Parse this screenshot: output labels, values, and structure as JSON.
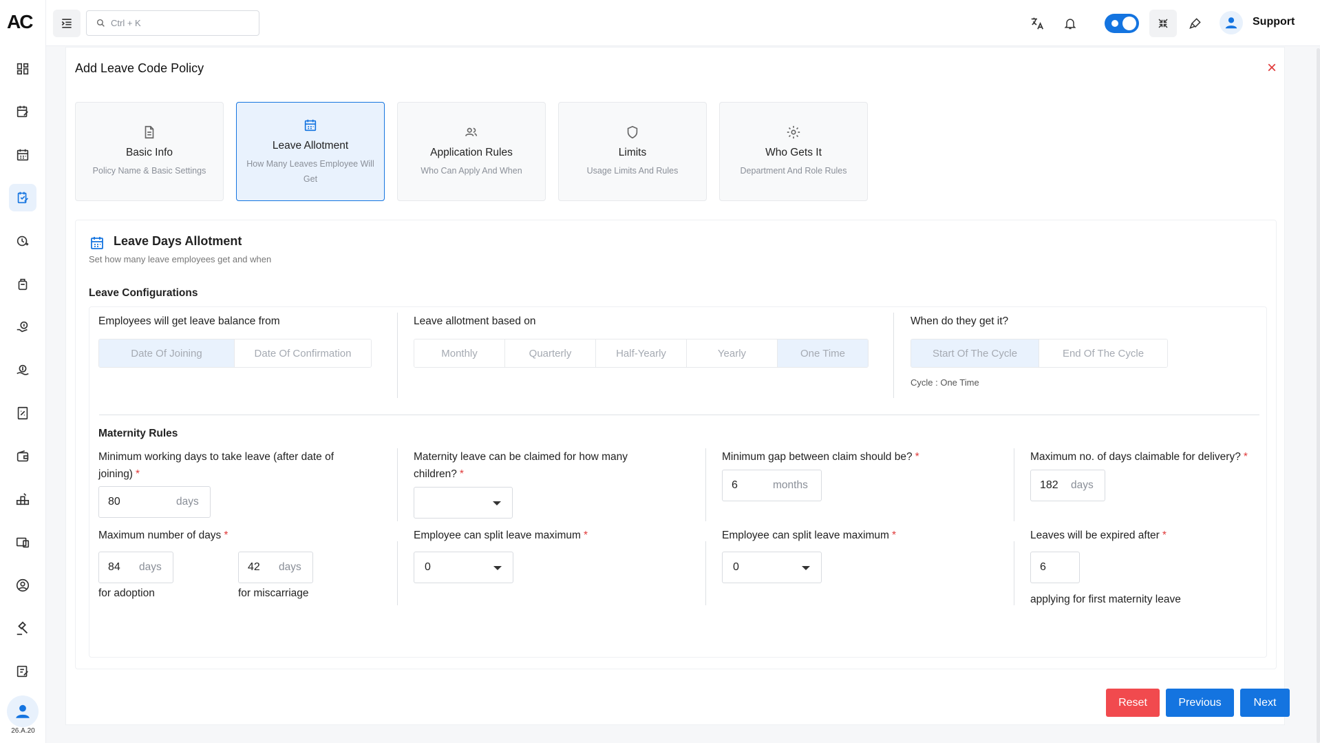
{
  "app": {
    "logo": "AC",
    "version": "26.A.20"
  },
  "topbar": {
    "search_placeholder": "Ctrl + K",
    "user_name": "Support"
  },
  "page": {
    "title": "Add Leave Code Policy"
  },
  "steps": [
    {
      "title": "Basic Info",
      "subtitle": "Policy Name & Basic Settings",
      "icon": "document-icon",
      "active": false
    },
    {
      "title": "Leave Allotment",
      "subtitle": "How Many Leaves Employee Will Get",
      "icon": "calendar-icon",
      "active": true
    },
    {
      "title": "Application Rules",
      "subtitle": "Who Can Apply And When",
      "icon": "users-icon",
      "active": false
    },
    {
      "title": "Limits",
      "subtitle": "Usage Limits And Rules",
      "icon": "shield-icon",
      "active": false
    },
    {
      "title": "Who Gets It",
      "subtitle": "Department And Role Rules",
      "icon": "gear-icon",
      "active": false
    }
  ],
  "section": {
    "title": "Leave Days Allotment",
    "subtitle": "Set how many leave employees get and when",
    "config_title": "Leave Configurations",
    "balance_from": {
      "label": "Employees will get leave balance from",
      "options": [
        "Date Of Joining",
        "Date Of Confirmation"
      ],
      "selected": "Date Of Joining"
    },
    "allotment_based": {
      "label": "Leave allotment based on",
      "options": [
        "Monthly",
        "Quarterly",
        "Half-Yearly",
        "Yearly",
        "One Time"
      ],
      "selected": "One Time"
    },
    "when_get": {
      "label": "When do they get it?",
      "options": [
        "Start Of The Cycle",
        "End Of The Cycle"
      ],
      "selected": "Start Of The Cycle",
      "cycle_note": "Cycle : One Time"
    },
    "maternity": {
      "title": "Maternity Rules",
      "min_working_days": {
        "label": "Minimum working days to take leave (after date of joining)",
        "value": "80",
        "unit": "days"
      },
      "children": {
        "label": "Maternity leave can be claimed for how many children?",
        "value": ""
      },
      "min_gap": {
        "label": "Minimum gap between claim should be?",
        "value": "6",
        "unit": "months"
      },
      "max_delivery": {
        "label": "Maximum no. of days claimable for delivery?",
        "value": "182",
        "unit": "days"
      },
      "max_days": {
        "label": "Maximum number of days",
        "adoption": {
          "value": "84",
          "unit": "days",
          "caption": "for adoption"
        },
        "miscarriage": {
          "value": "42",
          "unit": "days",
          "caption": "for miscarriage"
        }
      },
      "split_1": {
        "label": "Employee can split leave maximum",
        "value": "0"
      },
      "split_2": {
        "label": "Employee can split leave maximum",
        "value": "0"
      },
      "expire": {
        "label": "Leaves will be expired after",
        "value": "6",
        "caption": "applying for first maternity leave"
      }
    }
  },
  "buttons": {
    "reset": "Reset",
    "previous": "Previous",
    "next": "Next"
  },
  "colors": {
    "accent": "#1474e0",
    "danger": "#f14a4e",
    "selected_bg": "#e9f2fd"
  }
}
